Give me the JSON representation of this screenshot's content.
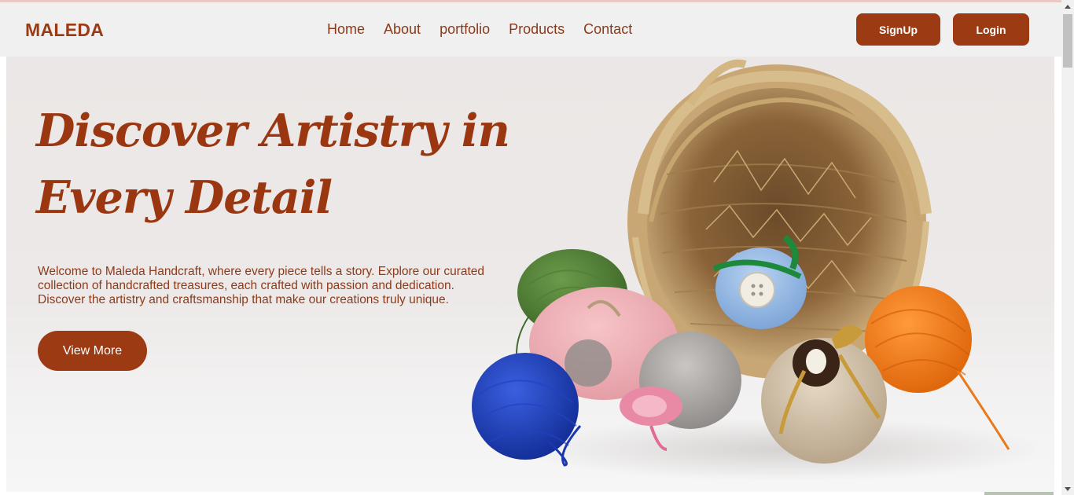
{
  "nav": {
    "brand": "MALEDA",
    "links": [
      "Home",
      "About",
      "portfolio",
      "Products",
      "Contact"
    ],
    "signup_label": "SignUp",
    "login_label": "Login"
  },
  "hero": {
    "title_line1": "Discover Artistry in",
    "title_line2": "Every Detail",
    "description": "Welcome to Maleda Handcraft, where every piece tells a story. Explore our curated collection of handcrafted treasures, each crafted with passion and dedication. Discover the artistry and craftsmanship that make our creations truly unique.",
    "cta_label": "View More",
    "image_subject": "woven-basket-with-yarn-balls-and-crochet-ornaments"
  },
  "colors": {
    "brand": "#9b3a13",
    "navbar_bg": "#f1f0f0",
    "hero_bg": "#ebe7e6"
  }
}
